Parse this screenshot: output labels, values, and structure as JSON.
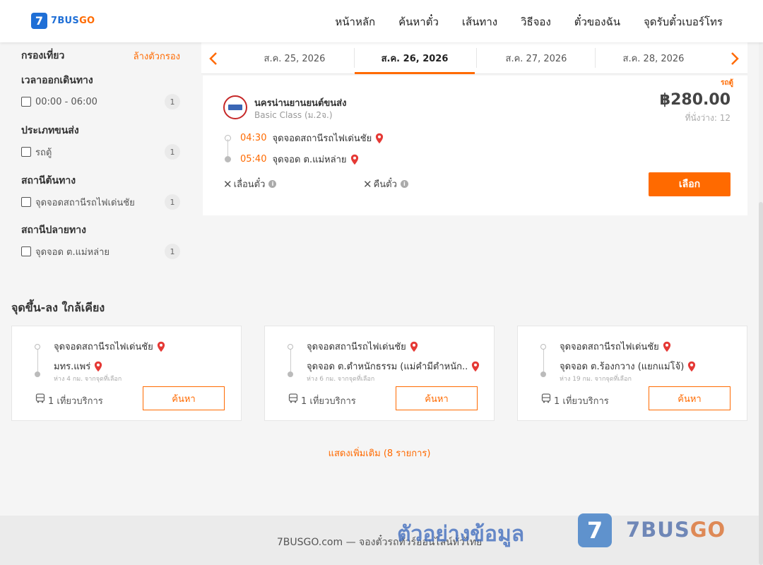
{
  "brand": {
    "badge": "7",
    "name_part1": "7BUS",
    "name_part2": "GO"
  },
  "nav": [
    {
      "label": "หน้าหลัก"
    },
    {
      "label": "ค้นหาตั๋ว"
    },
    {
      "label": "เส้นทาง"
    },
    {
      "label": "วิธีจอง"
    },
    {
      "label": "ตั๋วของฉัน"
    },
    {
      "label": "จุดรับตั๋วเบอร์โทร"
    }
  ],
  "filters": {
    "title": "กรองเที่ยว",
    "clear_label": "ล้างตัวกรอง",
    "groups": [
      {
        "title": "เวลาออกเดินทาง",
        "options": [
          {
            "label": "00:00 - 06:00",
            "count": "1"
          }
        ]
      },
      {
        "title": "ประเภทขนส่ง",
        "options": [
          {
            "label": "รถตู้",
            "count": "1"
          }
        ]
      },
      {
        "title": "สถานีต้นทาง",
        "options": [
          {
            "label": "จุดจอดสถานีรถไฟเด่นชัย",
            "count": "1"
          }
        ]
      },
      {
        "title": "สถานีปลายทาง",
        "options": [
          {
            "label": "จุดจอด ต.แม่หล่าย",
            "count": "1"
          }
        ]
      }
    ]
  },
  "dates": [
    {
      "label": "ส.ค. 25, 2026",
      "active": false
    },
    {
      "label": "ส.ค. 26, 2026",
      "active": true
    },
    {
      "label": "ส.ค. 27, 2026",
      "active": false
    },
    {
      "label": "ส.ค. 28, 2026",
      "active": false
    }
  ],
  "trip": {
    "vehicle_tag": "รถตู้",
    "operator": "นครน่านยานยนต์ขนส่ง",
    "class": "Basic Class (ม.2จ.)",
    "price": "฿280.00",
    "seats": "ที่นั่งว่าง: 12",
    "departure_time": "04:30",
    "departure_stop": "จุดจอดสถานีรถไฟเด่นชัย",
    "arrival_time": "05:40",
    "arrival_stop": "จุดจอด ต.แม่หล่าย",
    "reschedule_label": "เลื่อนตั๋ว",
    "refund_label": "คืนตั๋ว",
    "select_label": "เลือก"
  },
  "nearby": {
    "title": "จุดขึ้น-ลง ใกล้เคียง",
    "cards": [
      {
        "from": "จุดจอดสถานีรถไฟเด่นชัย",
        "to": "มทร.แพร่",
        "distance": "ห่าง 4 กม. จากจุดที่เลือก",
        "trips": "1 เที่ยวบริการ",
        "search_label": "ค้นหา"
      },
      {
        "from": "จุดจอดสถานีรถไฟเด่นชัย",
        "to": "จุดจอด ต.ตำหนักธรรม (แม่คำมีตำหนัก...",
        "distance": "ห่าง 6 กม. จากจุดที่เลือก",
        "trips": "1 เที่ยวบริการ",
        "search_label": "ค้นหา"
      },
      {
        "from": "จุดจอดสถานีรถไฟเด่นชัย",
        "to": "จุดจอด ต.ร้องกวาง (แยกแม่โจ้)",
        "distance": "ห่าง 19 กม. จากจุดที่เลือก",
        "trips": "1 เที่ยวบริการ",
        "search_label": "ค้นหา"
      }
    ],
    "show_more": "แสดงเพิ่มเติม (8 รายการ)"
  },
  "footer": {
    "text": "7BUSGO.com — จองตั๋วรถทัวร์ออนไลน์ทั่วไทย"
  },
  "watermark": {
    "text": "ตัวอย่างข้อมูล",
    "badge": "7",
    "brand_part1": "7BUS",
    "brand_part2": "GO"
  },
  "colors": {
    "accent": "#ff6a00",
    "brand_blue": "#1f6fd6",
    "pin_red": "#e53935"
  }
}
